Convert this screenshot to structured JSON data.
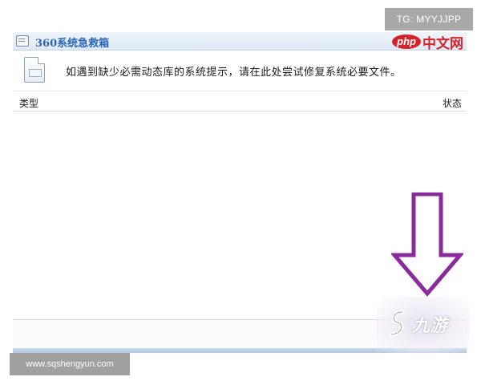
{
  "watermarks": {
    "tg": "TG: MYYJJPP",
    "url": "www.sqshengyun.com",
    "jiuyou": "九游"
  },
  "window": {
    "title": "360系统急救箱",
    "brand_logo": {
      "php": "php",
      "cn": "中文网"
    }
  },
  "notice": {
    "text": "如遇到缺少必需动态库的系统提示，请在此处尝试修复系统必要文件。",
    "icon": "dll-file-icon"
  },
  "table": {
    "columns": [
      "类型",
      "状态"
    ],
    "rows": []
  },
  "colors": {
    "title_text": "#2a66b8",
    "brand_red": "#d6232a",
    "arrow": "#8b2a9c"
  }
}
